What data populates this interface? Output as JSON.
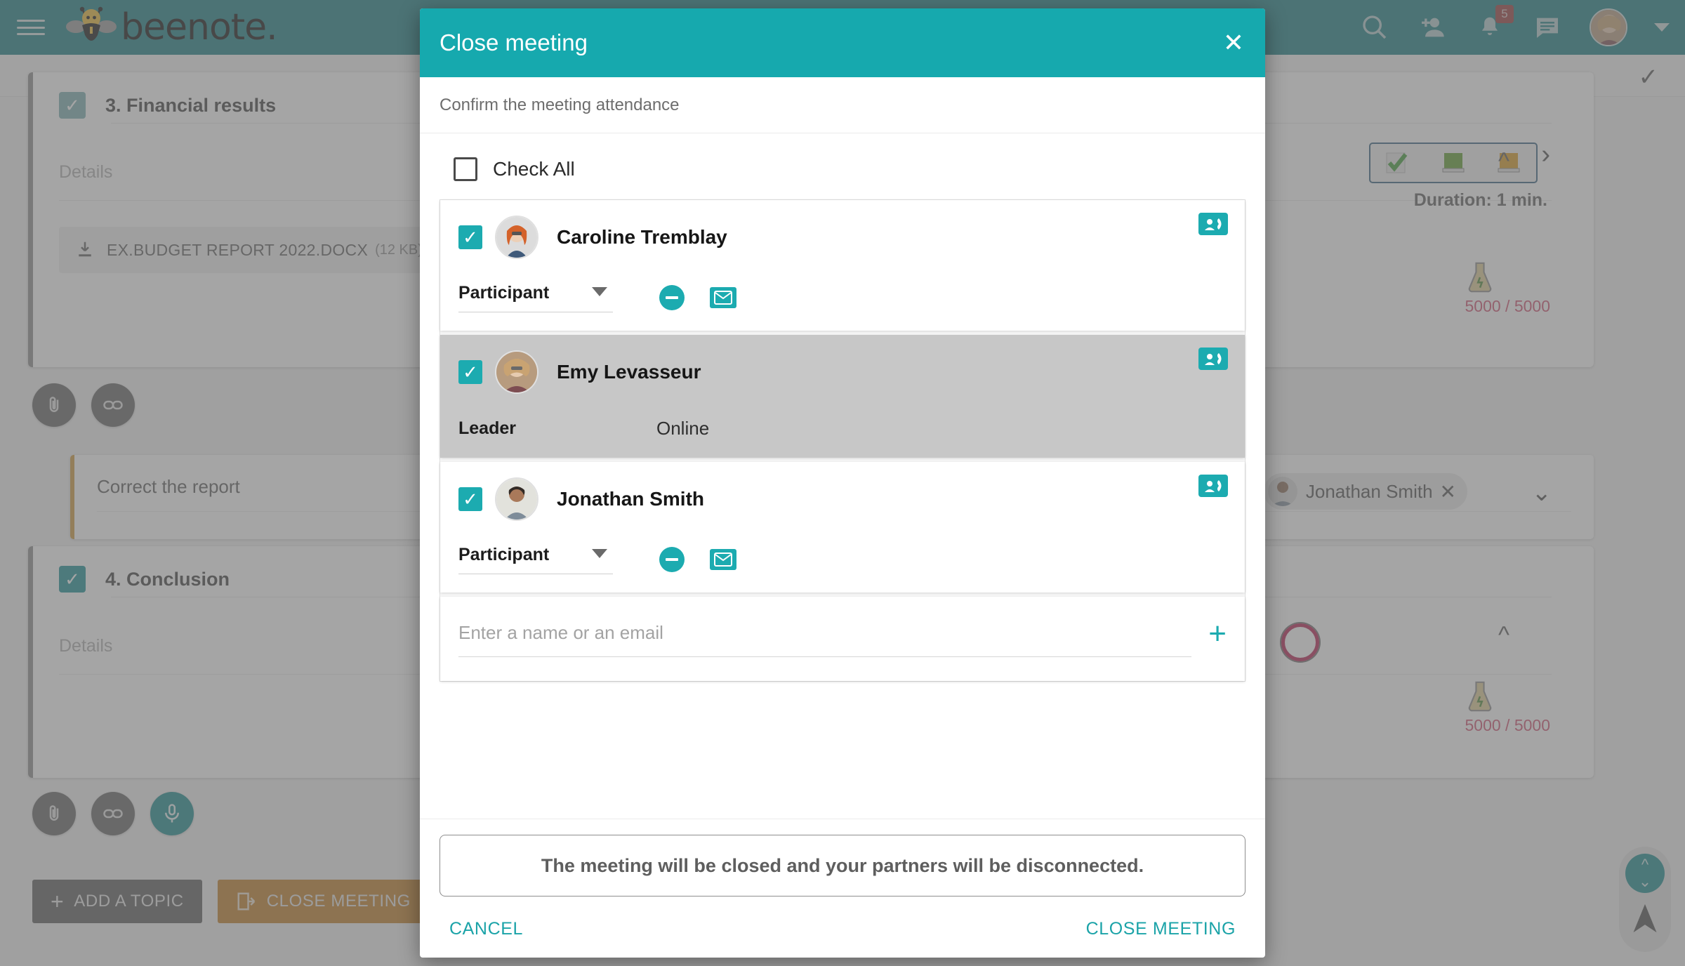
{
  "app": {
    "brand": "beenote.",
    "topbar": {
      "menu_icon": "hamburger-icon",
      "search_icon": "search-icon",
      "add_person_icon": "add-person-icon",
      "notifications_icon": "bell-icon",
      "notifications_count": "5",
      "chat_icon": "chat-icon",
      "avatar_icon": "user-avatar",
      "account_caret_icon": "chevron-down-icon"
    },
    "topics": [
      {
        "number_title": "3. Financial results",
        "details_placeholder": "Details",
        "attachment": {
          "name": "EX.BUDGET REPORT 2022.DOCX",
          "size": "(12 KB)"
        },
        "duration": "Duration: 1 min.",
        "char_count": "5000 / 5000"
      },
      {
        "number_title": "4. Conclusion",
        "details_placeholder": "Details",
        "char_count": "5000 / 5000"
      }
    ],
    "note": {
      "title": "Correct the report",
      "assignee": "Jonathan Smith"
    },
    "bottom_buttons": {
      "add_topic": "ADD A TOPIC",
      "close_meeting": "CLOSE MEETING"
    }
  },
  "modal": {
    "title": "Close meeting",
    "close_icon": "close-icon",
    "subtitle": "Confirm the meeting attendance",
    "check_all_label": "Check All",
    "participants": [
      {
        "name": "Caroline Tremblay",
        "role": "Participant",
        "status": "",
        "checked": true,
        "selected": false,
        "has_role_dropdown": true,
        "remove_icon": "minus-circle-icon",
        "email_icon": "envelope-icon",
        "contact_icon": "contact-card-icon"
      },
      {
        "name": "Emy Levasseur",
        "role": "Leader",
        "status": "Online",
        "checked": true,
        "selected": true,
        "has_role_dropdown": false,
        "contact_icon": "contact-card-icon"
      },
      {
        "name": "Jonathan Smith",
        "role": "Participant",
        "status": "",
        "checked": true,
        "selected": false,
        "has_role_dropdown": true,
        "remove_icon": "minus-circle-icon",
        "email_icon": "envelope-icon",
        "contact_icon": "contact-card-icon"
      }
    ],
    "add_placeholder": "Enter a name or an email",
    "add_icon": "plus-icon",
    "warning": "The meeting will be closed and your partners will be disconnected.",
    "cancel_label": "CANCEL",
    "confirm_label": "CLOSE MEETING"
  },
  "colors": {
    "brand_teal": "#157b80",
    "modal_teal": "#16a9ae",
    "accent_teal": "#1cabb0",
    "orange": "#c07d22",
    "note_accent": "#d09a3c",
    "record_red": "#b51e50"
  }
}
